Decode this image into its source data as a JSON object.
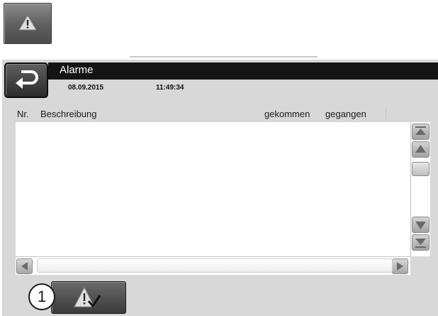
{
  "top_button": {
    "icon": "warning-triangle-icon"
  },
  "header": {
    "title": "Alarme",
    "date": "08.09.2015",
    "time": "11:49:34",
    "back_icon": "return-arrow-icon"
  },
  "table": {
    "columns": [
      "Nr.",
      "Beschreibung",
      "gekommen",
      "gegangen"
    ],
    "rows": []
  },
  "scrollbar": {
    "vertical_buttons": [
      "scroll-to-top",
      "scroll-up",
      "scroll-down",
      "scroll-to-bottom"
    ],
    "horizontal_buttons": [
      "scroll-left",
      "scroll-right"
    ]
  },
  "footer": {
    "acknowledge_icon": "warning-checkmark-icon",
    "callout_number": "1"
  },
  "colors": {
    "panel_bg": "#d8d8d8",
    "header_bar": "#141414",
    "button_dark": "#3a3a3a"
  }
}
